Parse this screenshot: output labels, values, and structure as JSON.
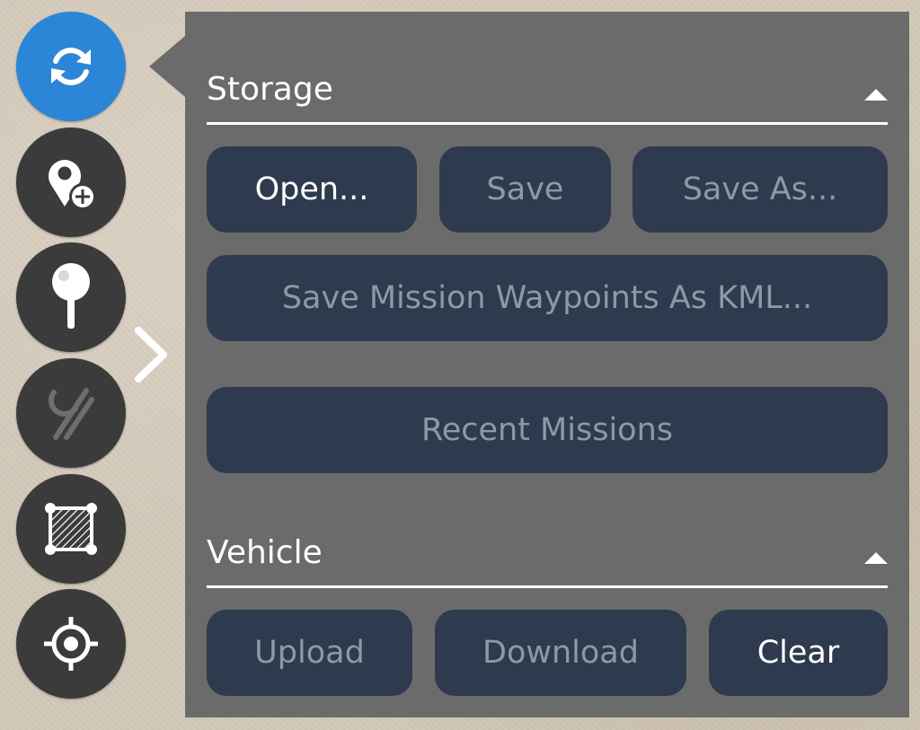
{
  "toolbar": {
    "tools": [
      {
        "name": "sync",
        "icon": "sync-icon",
        "active": true
      },
      {
        "name": "waypoint-add",
        "icon": "waypoint-add-icon",
        "active": false
      },
      {
        "name": "rally-point",
        "icon": "rally-point-icon",
        "active": false
      },
      {
        "name": "roi-disabled",
        "icon": "roi-disabled-icon",
        "active": false
      },
      {
        "name": "geofence",
        "icon": "geofence-icon",
        "active": false
      },
      {
        "name": "center",
        "icon": "crosshair-icon",
        "active": false
      }
    ],
    "expand_icon": "chevron-right-icon"
  },
  "colors": {
    "active_tool": "#2c86d8",
    "tool_bg": "#3b3b3b",
    "panel_bg": "#6b6b6b",
    "button_bg": "#2e3a4e",
    "button_text_disabled": "#8e98a6",
    "button_text_enabled": "#ffffff"
  },
  "panel": {
    "storage": {
      "title": "Storage",
      "collapse_icon": "triangle-up-icon",
      "buttons": {
        "open": "Open...",
        "save": "Save",
        "save_as": "Save As...",
        "save_kml": "Save Mission Waypoints As KML...",
        "recent": "Recent Missions"
      }
    },
    "vehicle": {
      "title": "Vehicle",
      "collapse_icon": "triangle-up-icon",
      "buttons": {
        "upload": "Upload",
        "download": "Download",
        "clear": "Clear"
      }
    }
  }
}
